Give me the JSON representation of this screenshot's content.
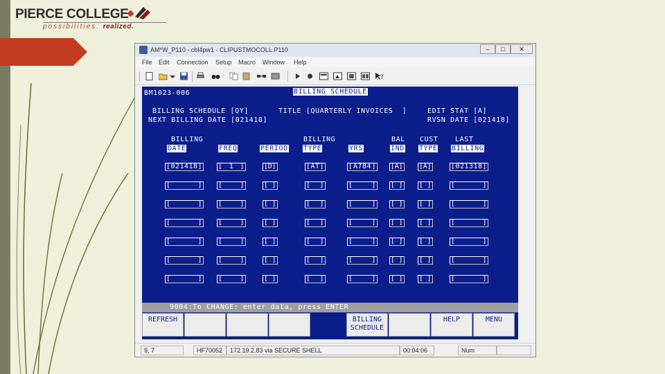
{
  "logo": {
    "title": "PIERCE COLLEGE",
    "tagline": "possibilities.",
    "tagline_bold": "realized."
  },
  "window": {
    "title": "AM*W_P110 - cbl4pw1 - CLIPUSTMOCOLL.P110",
    "buttons": {
      "minimize": "–",
      "maximize": "□",
      "close": "✕"
    }
  },
  "menu": [
    "File",
    "Edit",
    "Connection",
    "Setup",
    "Macro",
    "Window",
    "Help"
  ],
  "terminal": {
    "screen_id": "BM1023-006",
    "screen_title": "BILLING SCHEDULE",
    "line1_left": "BILLING SCHEDULE [QY]",
    "line1_mid": "TITLE [QUARTERLY INVOICES  ]",
    "line1_right": "EDIT STAT [A]",
    "line2_left": "NEXT BILLING DATE [021418]",
    "line2_right": "RVSN DATE [021418]",
    "headers_top": [
      "BILLING",
      "",
      "",
      "BILLING",
      "",
      "BAL",
      "CUST",
      "LAST"
    ],
    "headers": [
      "DATE",
      "FREQ",
      "PERIOD",
      "TYPE",
      "YRS",
      "IND",
      "TYPE",
      "BILLING"
    ],
    "row1": [
      "021418",
      "1",
      "D",
      "AT",
      "A784",
      "A",
      "A",
      "021318"
    ],
    "message": "9004:To CHANGE: enter data, press ENTER",
    "fkeys": [
      "REFRESH",
      "",
      "",
      "",
      "",
      "BILLING\nSCHEDULE",
      "",
      "HELP",
      "MENU"
    ]
  },
  "status": {
    "cursor": "9, 7",
    "session": "HF70052",
    "connection": "172.19.2.83 via SECURE SHELL",
    "time": "00:04:06",
    "mode": "Num"
  },
  "colors": {
    "terminal_bg": "#0c1d8c",
    "slide_bg": "#eef0db",
    "accent_red": "#c0392b"
  }
}
